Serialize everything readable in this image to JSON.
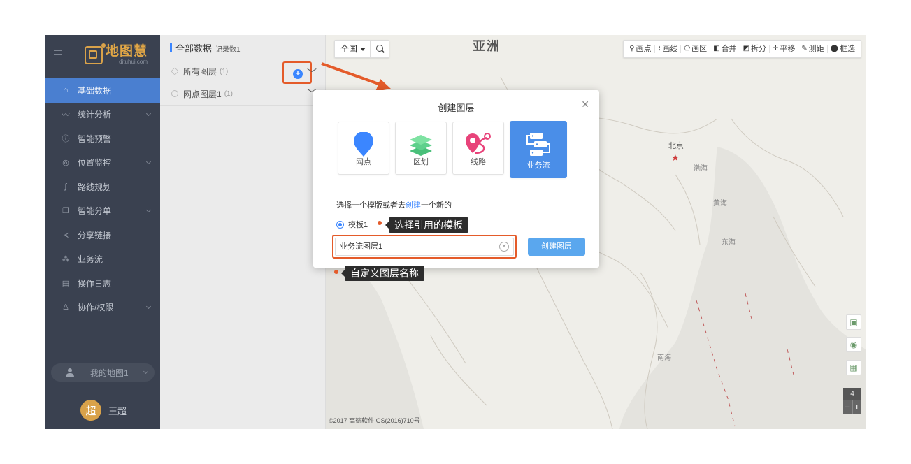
{
  "logo": {
    "cn": "地图慧",
    "en": "dituhui.com"
  },
  "sidebar": {
    "items": [
      {
        "label": "基础数据",
        "icon": "home-icon",
        "active": true,
        "chevron": false
      },
      {
        "label": "统计分析",
        "icon": "chart-icon",
        "active": false,
        "chevron": true
      },
      {
        "label": "智能预警",
        "icon": "alert-icon",
        "active": false,
        "chevron": false
      },
      {
        "label": "位置监控",
        "icon": "location-icon",
        "active": false,
        "chevron": true
      },
      {
        "label": "路线规划",
        "icon": "route-icon",
        "active": false,
        "chevron": false
      },
      {
        "label": "智能分单",
        "icon": "copy-icon",
        "active": false,
        "chevron": true
      },
      {
        "label": "分享链接",
        "icon": "share-icon",
        "active": false,
        "chevron": false
      },
      {
        "label": "业务流",
        "icon": "workflow-icon",
        "active": false,
        "chevron": false
      },
      {
        "label": "操作日志",
        "icon": "calendar-icon",
        "active": false,
        "chevron": false
      },
      {
        "label": "协作/权限",
        "icon": "user-group-icon",
        "active": false,
        "chevron": true
      }
    ],
    "my_map": "我的地图1",
    "user": {
      "avatar": "超",
      "name": "王超"
    }
  },
  "panel": {
    "title": "全部数据",
    "count": "记录数1",
    "layers": [
      {
        "name": "所有图层",
        "count": "(1)"
      },
      {
        "name": "网点图层1",
        "count": "(1)"
      }
    ]
  },
  "map": {
    "continent": "亚洲",
    "region": "全国",
    "labels": {
      "beijing": "北京",
      "bohai": "渤海",
      "yellow_sea": "黄海",
      "east_sea": "东海",
      "south_sea": "南海"
    },
    "copyright": "©2017 高德软件 GS(2016)710号",
    "zoom": "4",
    "tools": [
      {
        "icon": "pin-icon",
        "label": "画点"
      },
      {
        "icon": "polyline-icon",
        "label": "画线"
      },
      {
        "icon": "polygon-icon",
        "label": "画区"
      },
      {
        "icon": "merge-icon",
        "label": "合并"
      },
      {
        "icon": "split-icon",
        "label": "拆分"
      },
      {
        "icon": "move-icon",
        "label": "平移"
      },
      {
        "icon": "ruler-icon",
        "label": "测距"
      },
      {
        "icon": "select-icon",
        "label": "框选"
      }
    ]
  },
  "dialog": {
    "title": "创建图层",
    "types": [
      {
        "label": "网点",
        "icon": "point-icon",
        "selected": false
      },
      {
        "label": "区划",
        "icon": "layers-icon",
        "selected": false
      },
      {
        "label": "线路",
        "icon": "route-icon",
        "selected": false
      },
      {
        "label": "业务流",
        "icon": "workflow-icon",
        "selected": true
      }
    ],
    "hint_before": "选择一个模版或者去",
    "hint_link": "创建",
    "hint_after": "一个新的",
    "template": "模板1",
    "name_value": "业务流图层1",
    "create_label": "创建图层"
  },
  "annotations": {
    "template_tip": "选择引用的模板",
    "name_tip": "自定义图层名称"
  },
  "colors": {
    "sidebar": "#3a4150",
    "active": "#4a7fd0",
    "accent": "#3b86ff",
    "highlight": "#e45b2a",
    "logo": "#e0a646"
  }
}
